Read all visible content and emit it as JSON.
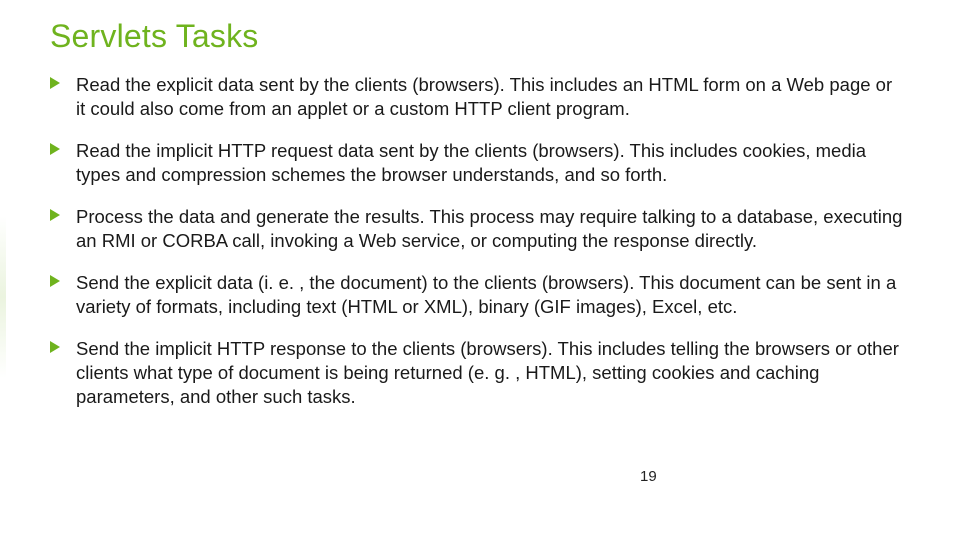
{
  "title": "Servlets Tasks",
  "bullets": [
    "Read the explicit data sent by the clients (browsers). This includes an HTML form on a Web page or it could also come from an applet or a custom HTTP client program.",
    "Read the implicit HTTP request data sent by the clients (browsers). This includes cookies, media types and compression schemes the browser understands, and so forth.",
    "Process the data and generate the results. This process may require talking to a database, executing an RMI or CORBA call, invoking a Web service, or computing the response directly.",
    "Send the explicit data (i. e. , the document) to the clients (browsers). This document can be sent in a variety of formats, including text (HTML or XML), binary (GIF images), Excel, etc.",
    "Send the implicit HTTP response to the clients (browsers). This includes telling the browsers or other clients what type of document is being returned (e. g. , HTML), setting cookies and caching parameters, and other such tasks."
  ],
  "page_number": "19"
}
